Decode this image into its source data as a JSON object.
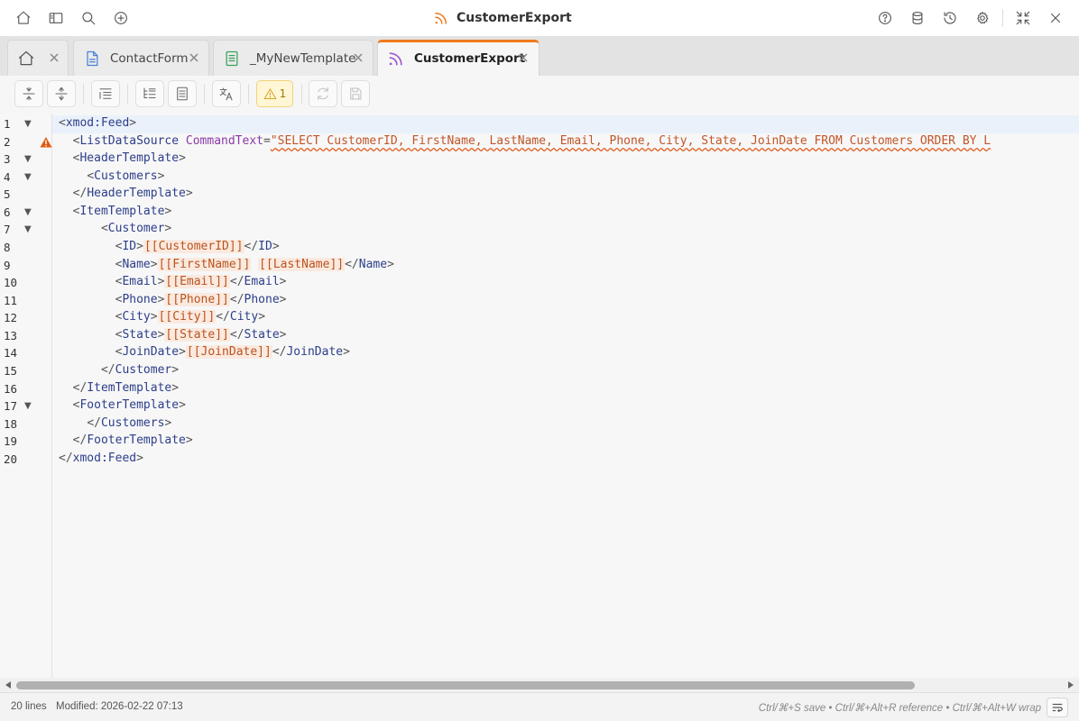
{
  "window": {
    "title": "CustomerExport"
  },
  "tabs": [
    {
      "label": "",
      "icon": "home-icon"
    },
    {
      "label": "ContactForm",
      "icon": "form-document-icon"
    },
    {
      "label": "_MyNewTemplate",
      "icon": "template-document-icon"
    },
    {
      "label": "CustomerExport",
      "icon": "rss-feed-icon",
      "active": true
    }
  ],
  "toolbar": {
    "warning_count": "1"
  },
  "editor": {
    "line_numbers": [
      "1",
      "2",
      "3",
      "4",
      "5",
      "6",
      "7",
      "8",
      "9",
      "10",
      "11",
      "12",
      "13",
      "14",
      "15",
      "16",
      "17",
      "18",
      "19",
      "20"
    ],
    "code": {
      "l1_tag": "xmod:Feed",
      "l2_tag": "ListDataSource",
      "l2_attr": "CommandText",
      "l2_value": "SELECT CustomerID, FirstName, LastName, Email, Phone, City, State, JoinDate FROM Customers ORDER BY L",
      "l3_tag": "HeaderTemplate",
      "l4_tag": "Customers",
      "l5_tag": "HeaderTemplate",
      "l6_tag": "ItemTemplate",
      "l7_tag": "Customer",
      "l8_tag": "ID",
      "l8_token": "[[CustomerID]]",
      "l9_tag": "Name",
      "l9_token1": "[[FirstName]]",
      "l9_token2": "[[LastName]]",
      "l10_tag": "Email",
      "l10_token": "[[Email]]",
      "l11_tag": "Phone",
      "l11_token": "[[Phone]]",
      "l12_tag": "City",
      "l12_token": "[[City]]",
      "l13_tag": "State",
      "l13_token": "[[State]]",
      "l14_tag": "JoinDate",
      "l14_token": "[[JoinDate]]",
      "l15_tag": "Customer",
      "l16_tag": "ItemTemplate",
      "l17_tag": "FooterTemplate",
      "l18_tag": "Customers",
      "l19_tag": "FooterTemplate",
      "l20_tag": "xmod:Feed"
    }
  },
  "status": {
    "lines": "20 lines",
    "modified": "Modified: 2026-02-22 07:13",
    "hint": "Ctrl/⌘+S save • Ctrl/⌘+Alt+R reference • Ctrl/⌘+Alt+W wrap"
  },
  "colors": {
    "accent": "#f07b1e",
    "warning": "#e05a10"
  }
}
